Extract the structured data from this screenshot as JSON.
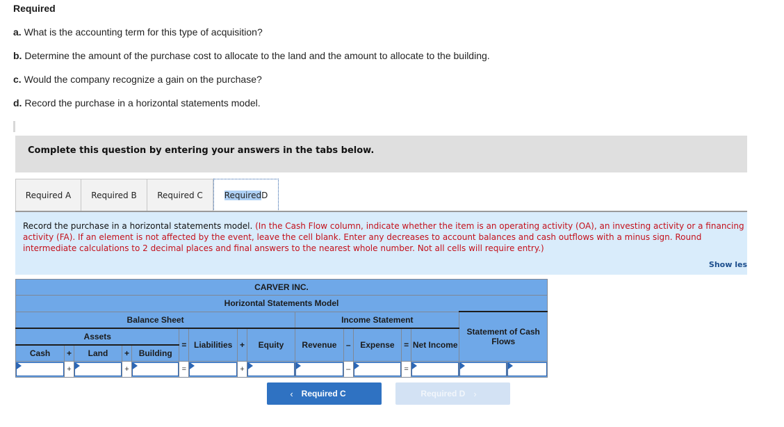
{
  "required": {
    "title": "Required",
    "questions": [
      {
        "letter": "a.",
        "text": " What is the accounting term for this type of acquisition?"
      },
      {
        "letter": "b.",
        "text": " Determine the amount of the purchase cost to allocate to the land and the amount to allocate to the building."
      },
      {
        "letter": "c.",
        "text": " Would the company recognize a gain on the purchase?"
      },
      {
        "letter": "d.",
        "text": " Record the purchase in a horizontal statements model."
      }
    ]
  },
  "instruction_box": "Complete this question by entering your answers in the tabs below.",
  "tabs": [
    {
      "label": "Required A",
      "active": false
    },
    {
      "label": "Required B",
      "active": false
    },
    {
      "label": "Required C",
      "active": false
    },
    {
      "label_highlight": "Required",
      "label_rest": " D",
      "active": true
    }
  ],
  "panel": {
    "lead": "Record the purchase in a horizontal statements model. ",
    "note": "(In the Cash Flow column, indicate whether the item is an operating activity (OA), an investing activity or a financing activity (FA). If an element is not affected by the event, leave the cell blank. Enter any decreases to account balances and cash outflows with a minus sign. Round intermediate calculations to 2 decimal places and final answers to the nearest whole number. Not all cells will require entry.)",
    "show_less": "Show les"
  },
  "model": {
    "company": "CARVER INC.",
    "title": "Horizontal Statements Model",
    "balance_sheet": "Balance Sheet",
    "income_statement": "Income Statement",
    "cash_flows": "Statement of Cash Flows",
    "assets": "Assets",
    "columns": {
      "cash": "Cash",
      "land": "Land",
      "building": "Building",
      "liabilities": "Liabilities",
      "equity": "Equity",
      "revenue": "Revenue",
      "expense": "Expense",
      "net_income": "Net Income"
    },
    "ops": {
      "plus": "+",
      "equals": "=",
      "minus": "–"
    },
    "inputs": {
      "cash": "",
      "land": "",
      "building": "",
      "liabilities": "",
      "equity": "",
      "revenue": "",
      "expense": "",
      "net_income": "",
      "cash_flow_amount": "",
      "cash_flow_activity": ""
    }
  },
  "nav": {
    "prev_label": "Required C",
    "prev_icon": "‹",
    "next_label": "Required D",
    "next_icon": "›"
  }
}
